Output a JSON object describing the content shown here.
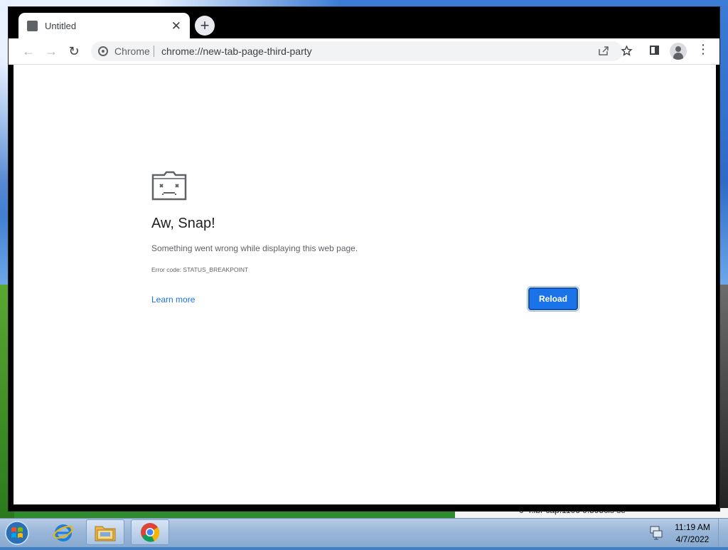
{
  "browser": {
    "tab": {
      "title": "Untitled",
      "close": "✕"
    },
    "newtab_label": "+",
    "toolbar": {
      "back": "←",
      "forward": "→",
      "reload": "↻",
      "omnibox": {
        "label": "Chrome",
        "url": "chrome://new-tab-page-third-party"
      },
      "menu": "⋮"
    }
  },
  "page": {
    "title": "Aw, Snap!",
    "message": "Something went wrong while displaying this web page.",
    "error_code": "Error code: STATUS_BREAKPOINT",
    "learn_more": "Learn more",
    "reload_button": "Reload"
  },
  "taskbar": {
    "clock": {
      "time": "11:19 AM",
      "date": "4/7/2022"
    }
  },
  "desktop": {
    "bottom_text": "0-4.lbr  cap.1106    0.595cls    se"
  },
  "colors": {
    "accent": "#1a73e8",
    "title_text": "#202124",
    "secondary_text": "#5f6368"
  },
  "icons": [
    "tab-favicon-icon",
    "new-tab-icon",
    "back-arrow-icon",
    "forward-arrow-icon",
    "reload-icon",
    "site-info-icon",
    "share-icon",
    "bookmark-star-icon",
    "side-panel-icon",
    "profile-icon",
    "menu-icon",
    "sad-tab-icon",
    "windows-start-icon",
    "internet-explorer-icon",
    "file-explorer-icon",
    "chrome-icon",
    "network-icon"
  ]
}
